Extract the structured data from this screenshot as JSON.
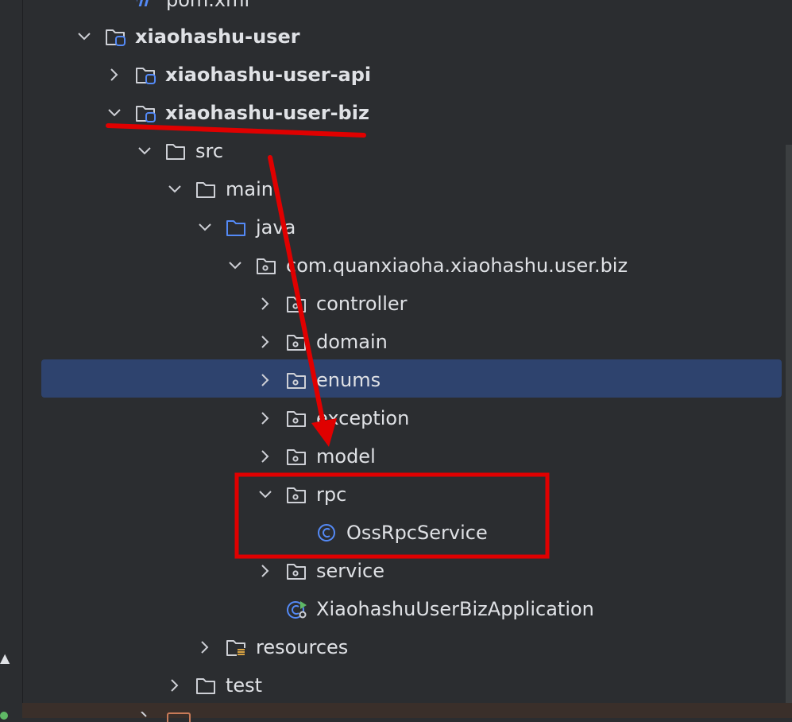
{
  "tree": {
    "partial_top": "pom.xml",
    "rows": [
      {
        "label": "xiaohashu-user",
        "expanded": true,
        "icon": "module-folder-icon",
        "bold": true
      },
      {
        "label": "xiaohashu-user-api",
        "expanded": false,
        "icon": "module-folder-icon",
        "bold": true
      },
      {
        "label": "xiaohashu-user-biz",
        "expanded": true,
        "icon": "module-folder-icon",
        "bold": true
      },
      {
        "label": "src",
        "expanded": true,
        "icon": "folder-icon"
      },
      {
        "label": "main",
        "expanded": true,
        "icon": "folder-icon"
      },
      {
        "label": "java",
        "expanded": true,
        "icon": "source-folder-icon"
      },
      {
        "label": "com.quanxiaoha.xiaohashu.user.biz",
        "expanded": true,
        "icon": "package-icon"
      },
      {
        "label": "controller",
        "expanded": false,
        "icon": "package-icon"
      },
      {
        "label": "domain",
        "expanded": false,
        "icon": "package-icon"
      },
      {
        "label": "enums",
        "expanded": false,
        "icon": "package-icon",
        "selected": true
      },
      {
        "label": "exception",
        "expanded": false,
        "icon": "package-icon"
      },
      {
        "label": "model",
        "expanded": false,
        "icon": "package-icon"
      },
      {
        "label": "rpc",
        "expanded": true,
        "icon": "package-icon"
      },
      {
        "label": "OssRpcService",
        "icon": "class-icon"
      },
      {
        "label": "service",
        "expanded": false,
        "icon": "package-icon"
      },
      {
        "label": "XiaohashuUserBizApplication",
        "icon": "spring-boot-class-icon"
      },
      {
        "label": "resources",
        "expanded": false,
        "icon": "resources-folder-icon"
      },
      {
        "label": "test",
        "expanded": false,
        "icon": "folder-icon"
      }
    ]
  },
  "colors": {
    "background": "#2b2d30",
    "selection": "#2e436e",
    "text": "#dfe1e5",
    "folder_stroke": "#ced0d6",
    "source_folder_stroke": "#548af7",
    "module_badge": "#548af7",
    "annotation_red": "#e00000"
  }
}
